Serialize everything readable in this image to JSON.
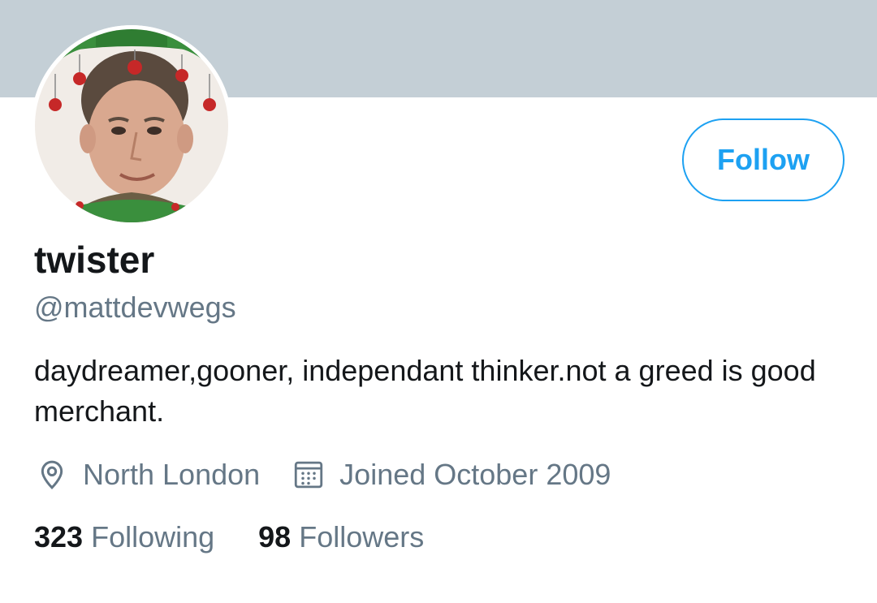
{
  "profile": {
    "display_name": "twister",
    "handle": "@mattdevwegs",
    "bio": "daydreamer,gooner, independant thinker.not a greed is good merchant.",
    "location": "North London",
    "joined": "Joined October 2009",
    "following_count": "323",
    "following_label": "Following",
    "followers_count": "98",
    "followers_label": "Followers"
  },
  "actions": {
    "follow_label": "Follow"
  },
  "icons": {
    "location": "location-pin-icon",
    "joined": "calendar-icon"
  },
  "colors": {
    "banner": "#c4cfd6",
    "accent": "#1da1f2",
    "primary_text": "#14171a",
    "secondary_text": "#657786"
  }
}
